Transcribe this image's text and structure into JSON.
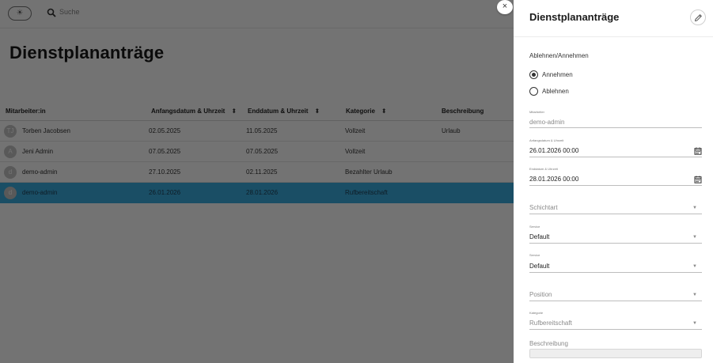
{
  "app": {
    "search_placeholder": "Suche",
    "page_title": "Dienstplananträge"
  },
  "table": {
    "headers": [
      {
        "label": "Mitarbeiter:in",
        "sortable": false
      },
      {
        "label": "Anfangsdatum & Uhrzeit",
        "sortable": true
      },
      {
        "label": "Enddatum & Uhrzeit",
        "sortable": true
      },
      {
        "label": "Kategorie",
        "sortable": true
      },
      {
        "label": "Beschreibung",
        "sortable": false
      }
    ],
    "rows": [
      {
        "initials": "TJ",
        "name": "Torben Jacobsen",
        "start": "02.05.2025",
        "end": "11.05.2025",
        "category": "Vollzeit",
        "description": "Urlaub",
        "selected": false
      },
      {
        "initials": "A",
        "name": "Jeni Admin",
        "start": "07.05.2025",
        "end": "07.05.2025",
        "category": "Vollzeit",
        "description": "",
        "selected": false
      },
      {
        "initials": "d",
        "name": "demo-admin",
        "start": "27.10.2025",
        "end": "02.11.2025",
        "category": "Bezahlter Urlaub",
        "description": "",
        "selected": false
      },
      {
        "initials": "d",
        "name": "demo-admin",
        "start": "26.01.2026",
        "end": "28.01.2026",
        "category": "Rufbereitschaft",
        "description": "",
        "selected": true
      }
    ]
  },
  "close_label": "×",
  "panel": {
    "title": "Dienstplananträge",
    "decision_label": "Ablehnen/Annehmen",
    "options": [
      {
        "label": "Annehmen",
        "checked": true
      },
      {
        "label": "Ablehnen",
        "checked": false
      }
    ],
    "fields": {
      "employee": {
        "label": "Mitarbeiter",
        "value": "demo-admin"
      },
      "start": {
        "label": "Anfangsdatum & Uhrzeit",
        "value": "26.01.2026 00:00"
      },
      "end": {
        "label": "Enddatum & Uhrzeit",
        "value": "28.01.2026 00:00"
      },
      "shift_type": {
        "placeholder": "Schichtart"
      },
      "service1": {
        "label": "Service",
        "value": "Default"
      },
      "service2": {
        "label": "Service",
        "value": "Default"
      },
      "position": {
        "placeholder": "Position"
      },
      "category": {
        "label": "Kategorie",
        "value": "Rufbereitschaft"
      },
      "description": {
        "placeholder": "Beschreibung"
      }
    }
  },
  "colors": {
    "selected_row": "#3aaee0",
    "scrim": "rgba(0,0,0,0.55)"
  }
}
